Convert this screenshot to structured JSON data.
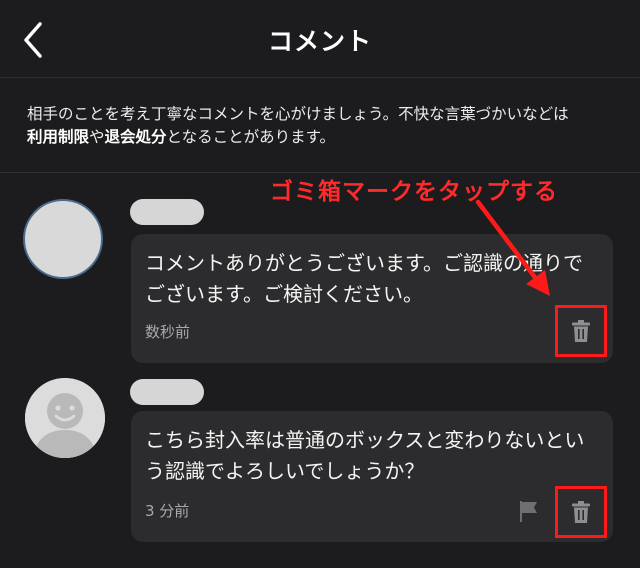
{
  "header": {
    "title": "コメント"
  },
  "notice": {
    "line1": "相手のことを考え丁寧なコメントを心がけましょう。不快な言葉づかいなどは",
    "bold1": "利用制限",
    "connector": "や",
    "bold2": "退会処分",
    "tail": "となることがあります。"
  },
  "annotation": {
    "text": "ゴミ箱マークをタップする",
    "color": "#ff2a2a"
  },
  "comments": [
    {
      "text": "コメントありがとうございます。ご認識の通りでございます。ご検討ください。",
      "time": "数秒前",
      "avatar_icon": "blank-avatar-icon",
      "actions": [
        "trash-icon"
      ]
    },
    {
      "text": "こちら封入率は普通のボックスと変わりないという認識でよろしいでしょうか？",
      "time": "3 分前",
      "avatar_icon": "smiley-avatar-icon",
      "actions": [
        "flag-icon",
        "trash-icon"
      ]
    }
  ],
  "colors": {
    "background": "#1c1c1e",
    "bubble": "#2c2c2e",
    "highlight": "#ff1a1a",
    "icon": "#8e8e93"
  }
}
